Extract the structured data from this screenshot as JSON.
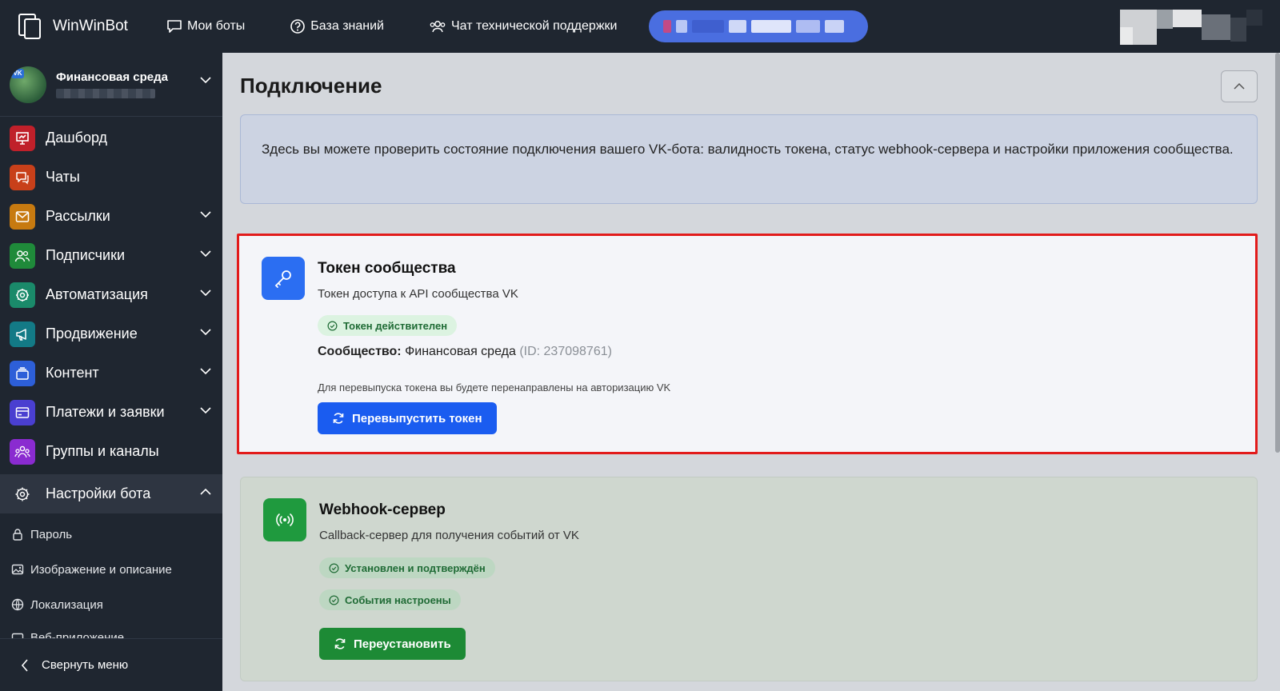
{
  "topbar": {
    "brand": "WinWinBot",
    "nav": [
      {
        "label": "Мои боты",
        "icon": "chat-bubble-icon"
      },
      {
        "label": "База знаний",
        "icon": "help-circle-icon"
      },
      {
        "label": "Чат технической поддержки",
        "icon": "users-icon"
      }
    ]
  },
  "sidebar": {
    "org_name": "Финансовая среда",
    "items": [
      {
        "label": "Дашборд",
        "icon": "dashboard-icon",
        "color": "#c0202a"
      },
      {
        "label": "Чаты",
        "icon": "chats-icon",
        "color": "#c8401a"
      },
      {
        "label": "Рассылки",
        "icon": "mail-icon",
        "color": "#c77a10"
      },
      {
        "label": "Подписчики",
        "icon": "subscribers-icon",
        "color": "#1f8a3a"
      },
      {
        "label": "Автоматизация",
        "icon": "automation-icon",
        "color": "#1a8a6a"
      },
      {
        "label": "Продвижение",
        "icon": "megaphone-icon",
        "color": "#137a86"
      },
      {
        "label": "Контент",
        "icon": "content-icon",
        "color": "#2d5fd8"
      },
      {
        "label": "Платежи и заявки",
        "icon": "card-icon",
        "color": "#4a3fd0"
      },
      {
        "label": "Группы и каналы",
        "icon": "groups-icon",
        "color": "#8a2bd0"
      },
      {
        "label": "Настройки бота",
        "icon": "gear-icon"
      }
    ],
    "sub_items": [
      {
        "label": "Пароль",
        "icon": "lock-icon"
      },
      {
        "label": "Изображение и описание",
        "icon": "image-icon"
      },
      {
        "label": "Локализация",
        "icon": "globe-icon"
      },
      {
        "label": "Веб-приложение",
        "icon": "window-icon"
      }
    ],
    "collapse_label": "Свернуть меню"
  },
  "main": {
    "title": "Подключение",
    "info": "Здесь вы можете проверить состояние подключения вашего VK-бота: валидность токена, статус webhook-сервера и настройки приложения сообщества.",
    "token_card": {
      "title": "Токен сообщества",
      "subtitle": "Токен доступа к API сообщества VK",
      "badge": "Токен действителен",
      "community_label": "Сообщество:",
      "community_name": "Финансовая среда",
      "community_id": "(ID: 237098761)",
      "note": "Для перевыпуска токена вы будете перенаправлены на авторизацию VK",
      "button": "Перевыпустить токен"
    },
    "webhook_card": {
      "title": "Webhook-сервер",
      "subtitle": "Callback-сервер для получения событий от VK",
      "badge1": "Установлен и подтверждён",
      "badge2": "События настроены",
      "button": "Переустановить"
    }
  },
  "colors": {
    "accent_blue": "#1a5cf0",
    "success_green": "#1d8a35",
    "highlight_red": "#e21b1b"
  }
}
